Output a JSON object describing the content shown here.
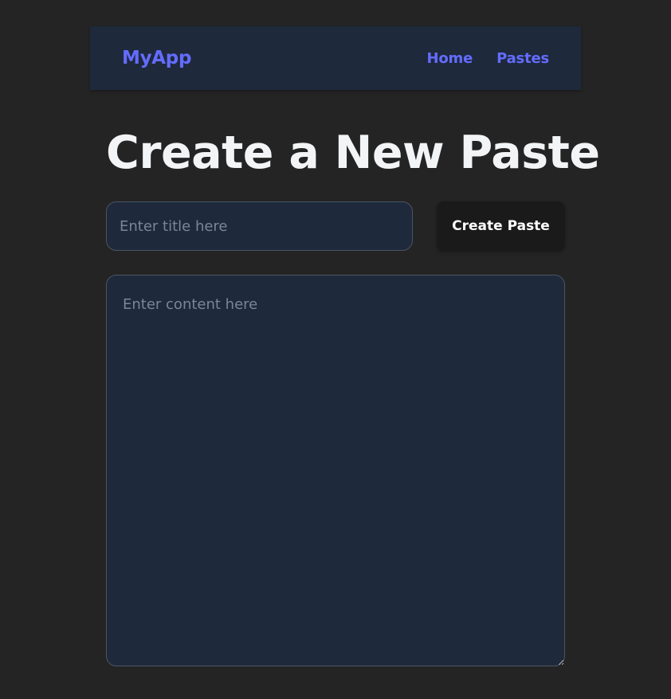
{
  "navbar": {
    "brand": "MyApp",
    "links": [
      {
        "label": "Home"
      },
      {
        "label": "Pastes"
      }
    ]
  },
  "page": {
    "title": "Create a New Paste"
  },
  "form": {
    "title_input": {
      "placeholder": "Enter title here",
      "value": ""
    },
    "create_button_label": "Create Paste",
    "content_textarea": {
      "placeholder": "Enter content here",
      "value": ""
    }
  },
  "colors": {
    "background": "#242424",
    "surface": "#1e293b",
    "accent": "#646cff",
    "button": "#1a1a1a",
    "heading": "#f3f4f6",
    "border": "#4b5563"
  }
}
